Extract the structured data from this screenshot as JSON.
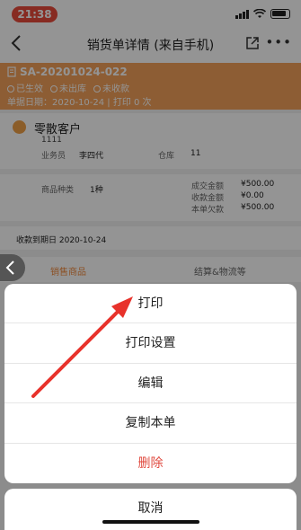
{
  "status_bar": {
    "time": "21:38"
  },
  "nav": {
    "title": "销货单详情 (来自手机)"
  },
  "order": {
    "number": "SA-20201024-022",
    "status": [
      "已生效",
      "未出库",
      "未收款"
    ],
    "date_line": "单据日期：2020-10-24 | 打印 0 次"
  },
  "customer": {
    "name": "零散客户",
    "code": "1111",
    "salesperson_label": "业务员",
    "salesperson_value": "李四代",
    "warehouse_label": "仓库",
    "warehouse_value": "11"
  },
  "summary": {
    "kinds_label": "商品种类",
    "kinds_value": "1种",
    "deal_label": "成交金额",
    "deal_value": "¥500.00",
    "received_label": "收款金额",
    "received_value": "¥0.00",
    "owed_label": "本单欠款",
    "owed_value": "¥500.00"
  },
  "receive": {
    "text": "收款到期日 2020-10-24"
  },
  "tabs": {
    "goods": "销售商品",
    "settle": "结算&物流等"
  },
  "action_sheet": {
    "items": [
      "打印",
      "打印设置",
      "编辑",
      "复制本单",
      "删除"
    ],
    "cancel": "取消"
  },
  "colors": {
    "accent": "#f3a15a",
    "danger": "#e04a3f",
    "arrow": "#e8322b"
  }
}
